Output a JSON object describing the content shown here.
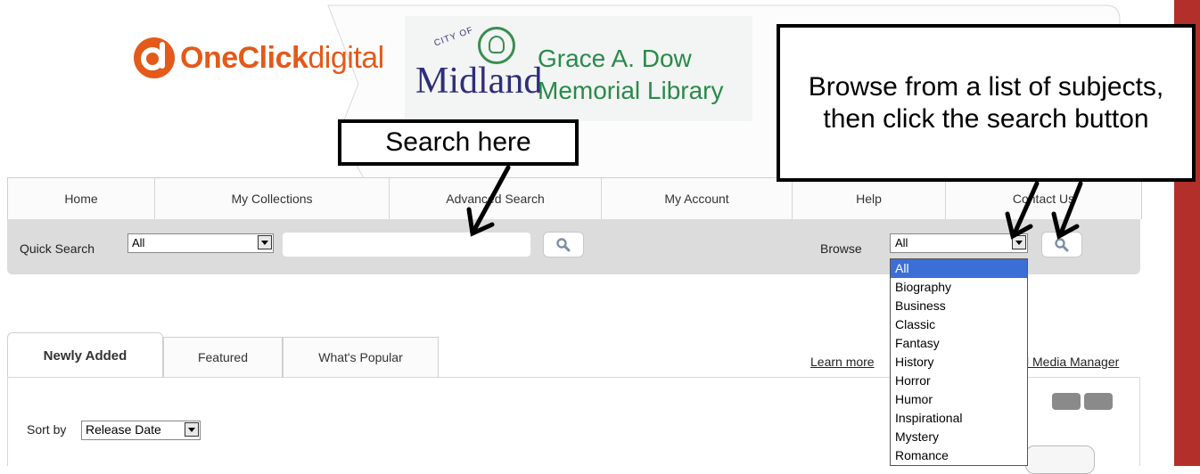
{
  "brand": {
    "name_bold": "OneClick",
    "name_light": "digital"
  },
  "library": {
    "city_label": "CITY OF",
    "city_name": "Midland",
    "name_line1": "Grace A. Dow",
    "name_line2": "Memorial Library"
  },
  "nav": {
    "items": [
      {
        "label": "Home"
      },
      {
        "label": "My Collections"
      },
      {
        "label": "Advanced Search"
      },
      {
        "label": "My Account"
      },
      {
        "label": "Help"
      },
      {
        "label": "Contact Us"
      }
    ]
  },
  "quick_search": {
    "label": "Quick Search",
    "scope_selected": "All",
    "query_value": "",
    "search_icon": "magnifier-icon"
  },
  "browse": {
    "label": "Browse",
    "selected": "All",
    "options": [
      "All",
      "Biography",
      "Business",
      "Classic",
      "Fantasy",
      "History",
      "Horror",
      "Humor",
      "Inspirational",
      "Mystery",
      "Romance"
    ]
  },
  "content_tabs": [
    {
      "label": "Newly Added",
      "active": true
    },
    {
      "label": "Featured",
      "active": false
    },
    {
      "label": "What's Popular",
      "active": false
    }
  ],
  "links": {
    "learn_more": "Learn more",
    "media_manager": "l Media Manager"
  },
  "sort": {
    "label": "Sort by",
    "selected": "Release Date"
  },
  "callouts": {
    "search": "Search here",
    "browse": "Browse from a list of subjects, then click the search button"
  },
  "colors": {
    "brand_orange": "#e35a1a",
    "library_green": "#2a8a4a",
    "library_navy": "#2e2e7a",
    "right_bar": "#b3302a",
    "selection_blue": "#3b6fd6",
    "search_bar_bg": "#dcdcdc"
  }
}
